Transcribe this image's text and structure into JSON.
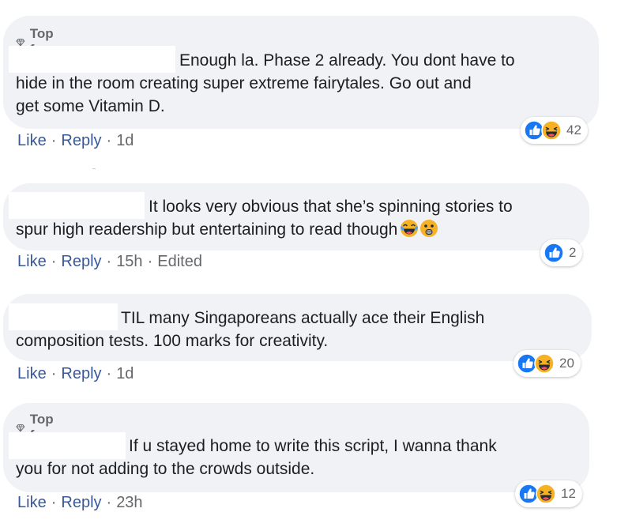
{
  "comments": [
    {
      "badge": "Top fan",
      "lines": [
        "Enough la. Phase 2 already. You dont have to",
        "hide in the room creating super extreme fairytales. Go out and",
        "get some Vitamin D."
      ],
      "like": "Like",
      "reply": "Reply",
      "time": "1d",
      "edited": "",
      "reaction_count": "42"
    },
    {
      "badge": "",
      "lines": [
        "It looks very obvious that she’s spinning stories to",
        "spur high readership but entertaining to read though"
      ],
      "like": "Like",
      "reply": "Reply",
      "time": "15h",
      "edited": "Edited",
      "reaction_count": "2"
    },
    {
      "badge": "",
      "lines": [
        "TIL many Singaporeans actually ace their English",
        "composition tests. 100 marks for creativity."
      ],
      "like": "Like",
      "reply": "Reply",
      "time": "1d",
      "edited": "",
      "reaction_count": "20"
    },
    {
      "badge": "Top fan",
      "lines": [
        "If u stayed home to write this script, I wanna thank",
        "you for not adding to the crowds outside."
      ],
      "like": "Like",
      "reply": "Reply",
      "time": "23h",
      "edited": "",
      "reaction_count": "12"
    }
  ],
  "separator": "·",
  "icons": {
    "badge": "diamond-icon",
    "like_reaction": "like-reaction-icon",
    "haha_reaction": "haha-reaction-icon",
    "inline_emoji_1": "tears-of-joy-emoji-icon",
    "inline_emoji_2": "astonished-emoji-icon"
  },
  "colors": {
    "bubble": "#f0f2f5",
    "link": "#385898",
    "meta": "#65676b",
    "like_blue": "#1877f2",
    "haha_yellow": "#f7b125"
  }
}
